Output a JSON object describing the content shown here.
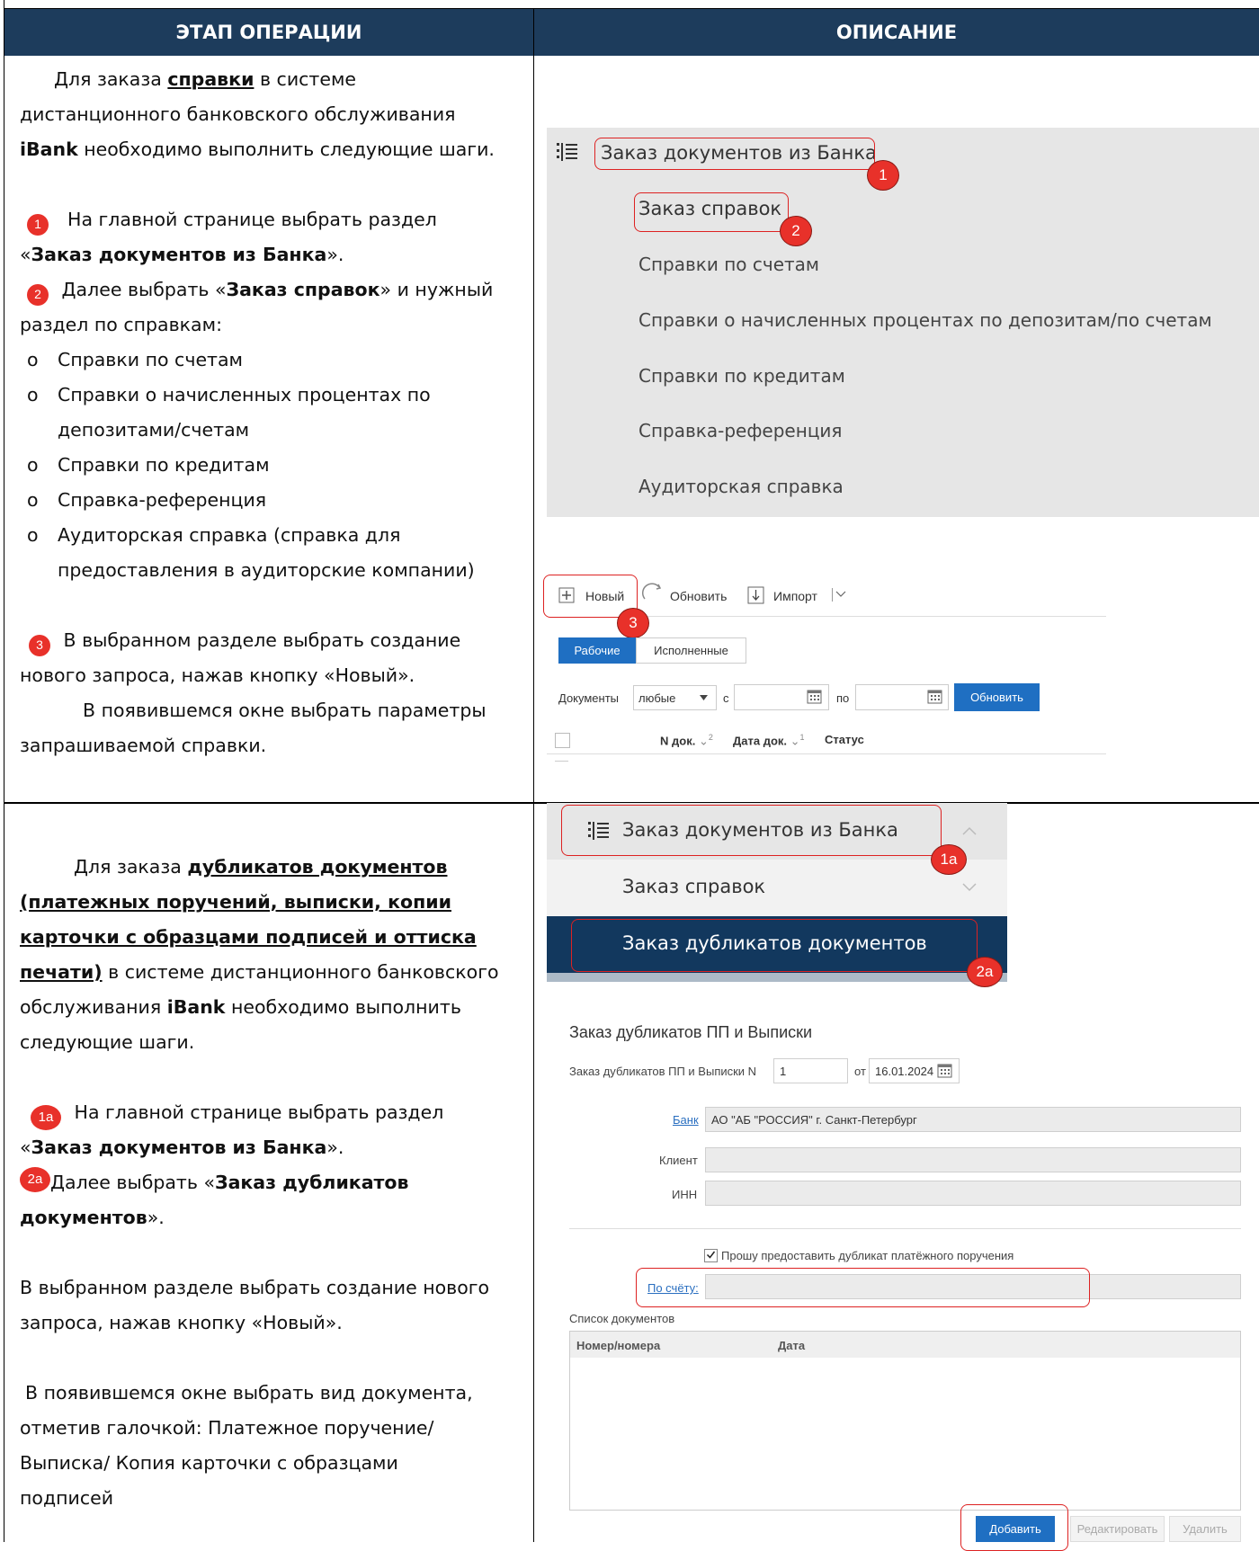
{
  "header": {
    "col_left": "ЭТАП ОПЕРАЦИИ",
    "col_right": "ОПИСАНИЕ"
  },
  "section1": {
    "intro_pre": "Для заказа ",
    "intro_link": "справки",
    "intro_post": " в системе",
    "intro_line2": "дистанционного банковского обслуживания",
    "intro_brand": "iBank",
    "intro_line3_rest": " необходимо выполнить следующие шаги.",
    "step1_badge": "1",
    "step1_text": "На главной странице выбрать раздел",
    "step1_quote_open": "«",
    "step1_bold": "Заказ документов из Банка",
    "step1_quote_close": "».",
    "step2_badge": "2",
    "step2_pre": "Далее выбрать «",
    "step2_bold": "Заказ справок",
    "step2_post": "» и нужный",
    "step2_line2": "раздел по справкам:",
    "bullet_marker": "o",
    "bullets": [
      "Справки по счетам",
      "Справки о начисленных процентах по",
      "депозитами/счетам",
      "Справки по кредитам",
      "Справка-референция",
      "Аудиторская справка (справка для",
      "предоставления в аудиторские компании)"
    ],
    "step3_badge": "3",
    "step3_text": "В выбранном разделе выбрать создание",
    "step3_line2": "нового запроса, нажав кнопку «Новый».",
    "step3_line3": "В появившемся окне выбрать параметры",
    "step3_line4": "запрашиваемой справки."
  },
  "menu1": {
    "title": "Заказ документов из Банка",
    "badge1": "1",
    "sub": "Заказ справок",
    "badge2": "2",
    "items": [
      "Справки по счетам",
      "Справки о начисленных процентах по депозитам/по счетам",
      "Справки по кредитам",
      "Справка-референция",
      "Аудиторская справка"
    ]
  },
  "toolbar": {
    "new_label": "Новый",
    "refresh_label": "Обновить",
    "import_label": "Импорт",
    "badge3": "3",
    "tab_active": "Рабочие",
    "tab_done": "Исполненные",
    "docs_label": "Документы",
    "docs_value": "любые",
    "from_label": "с",
    "to_label": "по",
    "refresh_button": "Обновить",
    "col_num": "N док.",
    "col_num_sort": "2",
    "col_date": "Дата док.",
    "col_date_sort": "1",
    "col_status": "Статус"
  },
  "section2": {
    "intro_pre": "Для заказа ",
    "intro_link_1": "дубликатов документов",
    "intro_link_2": "(платежных поручений, выписки, копии",
    "intro_link_3": "карточки с образцами подписей и оттиска",
    "intro_link_4": "печати)",
    "intro_post": " в системе дистанционного банковского",
    "intro_line_b": "обслуживания ",
    "intro_brand": "iBank",
    "intro_line_b_rest": " необходимо выполнить",
    "intro_line_c": "следующие шаги.",
    "step1_badge": "1a",
    "step1_text": "На главной странице выбрать раздел",
    "step1_quote_open": "«",
    "step1_bold": "Заказ документов из Банка",
    "step1_quote_close": "».",
    "step2_badge": "2a",
    "step2_pre": "Далее выбрать «",
    "step2_bold_1": "Заказ дубликатов",
    "step2_bold_2": "документов",
    "step2_post": "».",
    "step3_line1": "В выбранном разделе выбрать создание нового",
    "step3_line2": "запроса, нажав кнопку «Новый».",
    "step4_line1": "В появившемся окне выбрать вид документа,",
    "step4_line2": "отметив галочкой: Платежное поручение/",
    "step4_line3": "Выписка/ Копия карточки с образцами",
    "step4_line4": "подписей"
  },
  "menu2": {
    "title": "Заказ документов из Банка",
    "badge1a": "1a",
    "sub": "Заказ справок",
    "active": "Заказ дубликатов документов",
    "badge2a": "2a"
  },
  "form": {
    "title": "Заказ дубликатов ПП и Выписки",
    "num_label": "Заказ дубликатов ПП и Выписки N",
    "num_value": "1",
    "date_label": "от",
    "date_value": "16.01.2024",
    "bank_label": "Банк",
    "bank_value": "АО \"АБ \"РОССИЯ\" г. Санкт-Петербург",
    "client_label": "Клиент",
    "inn_label": "ИНН",
    "checkbox_label": "Прошу предоставить дубликат платёжного поручения",
    "account_label": "По счёту:",
    "list_label": "Список документов",
    "col_numbers": "Номер/номера",
    "col_date": "Дата",
    "add_button": "Добавить",
    "edit_button": "Редактировать",
    "delete_button": "Удалить"
  }
}
